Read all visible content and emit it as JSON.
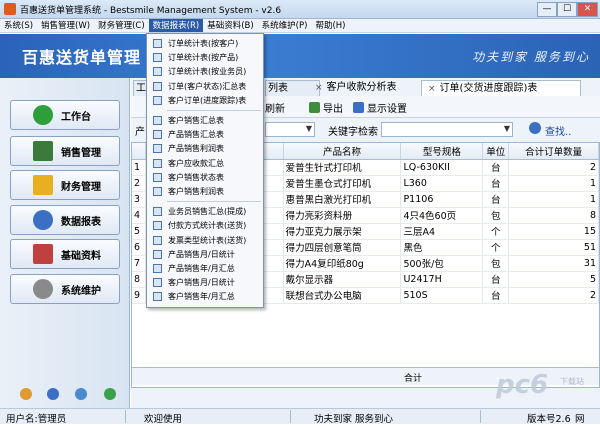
{
  "window": {
    "title": "百惠送货单管理系统 - Bestsmile Management System - v2.6",
    "min": "—",
    "max": "☐",
    "close": "✕"
  },
  "menubar": [
    "系统(S)",
    "销售管理(W)",
    "财务管理(C)",
    "数据报表(R)",
    "基础资料(B)",
    "系统维护(P)",
    "帮助(H)"
  ],
  "banner": {
    "brand": "百惠送货单管理",
    "slogan": "功夫到家 服务到心"
  },
  "sidebar": {
    "items": [
      {
        "label": "工作台",
        "color": "#2e9e3a"
      },
      {
        "label": "销售管理",
        "color": "#3a7a3a"
      },
      {
        "label": "财务管理",
        "color": "#e8b020"
      },
      {
        "label": "数据报表",
        "color": "#3b6fc4"
      },
      {
        "label": "基础资料",
        "color": "#c04040"
      },
      {
        "label": "系统维护",
        "color": "#8a8a8a"
      }
    ],
    "footer_icons": [
      "lock-icon",
      "clock-icon",
      "info-icon",
      "refresh-icon"
    ]
  },
  "tabs": [
    {
      "label": "工"
    },
    {
      "label": "列表"
    },
    {
      "label": "客户收款分析表"
    },
    {
      "label": "订单(交货进度跟踪)表"
    }
  ],
  "toolbar": {
    "refresh": "刷新",
    "export": "导出",
    "display_settings": "显示设置"
  },
  "filter": {
    "label_left": "产",
    "keyword_label": "关键字检索",
    "search": "查找.."
  },
  "grid": {
    "columns": [
      "",
      "编码",
      "产品名称",
      "型号规格",
      "单位",
      "合计订单数量"
    ],
    "rows": [
      [
        "1",
        "01001",
        "爱普生针式打印机",
        "LQ-630KII",
        "台",
        "2"
      ],
      [
        "2",
        "01002",
        "爱普生墨仓式打印机",
        "L360",
        "台",
        "1"
      ],
      [
        "3",
        "01003",
        "惠普黑白激光打印机",
        "P1106",
        "台",
        "1"
      ],
      [
        "4",
        "01005",
        "得力亮彩资料册",
        "4只4色60页",
        "包",
        "8"
      ],
      [
        "5",
        "01006",
        "得力亚克力展示架",
        "三层A4",
        "个",
        "15"
      ],
      [
        "6",
        "01007",
        "得力四层创意笔筒",
        "黑色",
        "个",
        "51"
      ],
      [
        "7",
        "01008",
        "得力A4复印纸80g",
        "500张/包",
        "包",
        "31"
      ],
      [
        "8",
        "01009",
        "戴尔显示器",
        "U2417H",
        "台",
        "5"
      ],
      [
        "9",
        "01010",
        "联想台式办公电脑",
        "510S",
        "台",
        "2"
      ]
    ],
    "sum_label": "合计"
  },
  "dropdown": {
    "groups": [
      [
        "订单统计表(按客户)",
        "订单统计表(按产品)",
        "订单统计表(按业务员)",
        "订单(客户状态)汇总表",
        "客户订单(进度跟踪)表"
      ],
      [
        "客户销售汇总表",
        "产品销售汇总表",
        "产品销售利润表",
        "客户应收款汇总",
        "客户销售状态表",
        "客户销售利润表"
      ],
      [
        "业务员销售汇总(提成)",
        "付款方式统计表(送货)",
        "发票类型统计表(送货)",
        "产品销售月/日统计",
        "产品销售年/月汇总",
        "客户销售月/日统计",
        "客户销售年/月汇总"
      ]
    ]
  },
  "statusbar": {
    "user": "用户名:管理员",
    "welcome": "欢迎使用",
    "slogan": "功夫到家 服务到心",
    "version": "版本号2.6",
    "extra": "网"
  },
  "watermark": {
    "text": "pc6",
    "sub": "下载站"
  }
}
